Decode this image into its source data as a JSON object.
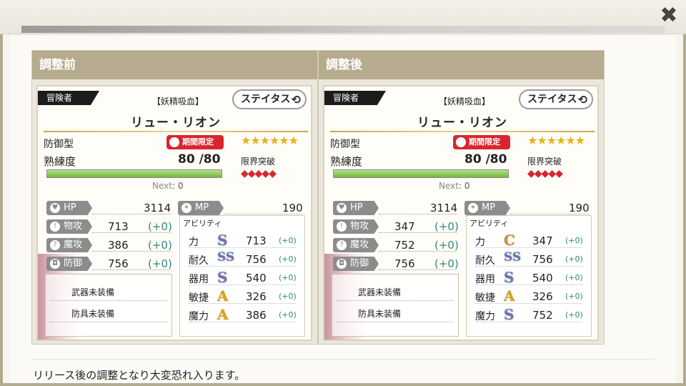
{
  "modal": {
    "close_label": "✖"
  },
  "panels": [
    {
      "header": "調整前",
      "card": {
        "tag": "冒険者",
        "subtitle": "【妖精吸血】",
        "status_button": "ステイタス",
        "name": "リュー・リオン",
        "role": "防御型",
        "limited_badge": "期間限定",
        "stars": "★★★★★★",
        "proficiency_label": "熟練度",
        "proficiency_value": "80 /80",
        "proficiency_progress": 1.0,
        "limit_break_label": "限界突破",
        "limit_diamonds": "◆◆◆◆◆",
        "next_label": "Next",
        "next_value": ": 0",
        "hp_label": "HP",
        "hp_value": "3114",
        "mp_label": "MP",
        "mp_value": "190",
        "stats": [
          {
            "label": "物攻",
            "value": "713",
            "delta": "(+0)"
          },
          {
            "label": "魔攻",
            "value": "386",
            "delta": "(+0)"
          },
          {
            "label": "防御",
            "value": "756",
            "delta": "(+0)"
          }
        ],
        "equipment": {
          "weapon": "武器未装備",
          "armor": "防具未装備"
        },
        "ability_title": "アビリティ",
        "abilities": [
          {
            "label": "力",
            "grade": "S",
            "value": "713",
            "delta": "(+0)"
          },
          {
            "label": "耐久",
            "grade": "SS",
            "value": "756",
            "delta": "(+0)"
          },
          {
            "label": "器用",
            "grade": "S",
            "value": "540",
            "delta": "(+0)"
          },
          {
            "label": "敏捷",
            "grade": "A",
            "value": "326",
            "delta": "(+0)"
          },
          {
            "label": "魔力",
            "grade": "A",
            "value": "386",
            "delta": "(+0)"
          }
        ]
      }
    },
    {
      "header": "調整後",
      "card": {
        "tag": "冒険者",
        "subtitle": "【妖精吸血】",
        "status_button": "ステイタス",
        "name": "リュー・リオン",
        "role": "防御型",
        "limited_badge": "期間限定",
        "stars": "★★★★★★",
        "proficiency_label": "熟練度",
        "proficiency_value": "80 /80",
        "proficiency_progress": 1.0,
        "limit_break_label": "限界突破",
        "limit_diamonds": "◆◆◆◆◆",
        "next_label": "Next",
        "next_value": ": 0",
        "hp_label": "HP",
        "hp_value": "3114",
        "mp_label": "MP",
        "mp_value": "190",
        "stats": [
          {
            "label": "物攻",
            "value": "347",
            "delta": "(+0)"
          },
          {
            "label": "魔攻",
            "value": "752",
            "delta": "(+0)"
          },
          {
            "label": "防御",
            "value": "756",
            "delta": "(+0)"
          }
        ],
        "equipment": {
          "weapon": "武器未装備",
          "armor": "防具未装備"
        },
        "ability_title": "アビリティ",
        "abilities": [
          {
            "label": "力",
            "grade": "C",
            "value": "347",
            "delta": "(+0)"
          },
          {
            "label": "耐久",
            "grade": "SS",
            "value": "756",
            "delta": "(+0)"
          },
          {
            "label": "器用",
            "grade": "S",
            "value": "540",
            "delta": "(+0)"
          },
          {
            "label": "敏捷",
            "grade": "A",
            "value": "326",
            "delta": "(+0)"
          },
          {
            "label": "魔力",
            "grade": "S",
            "value": "752",
            "delta": "(+0)"
          }
        ]
      }
    }
  ],
  "footer_note": "リリース後の調整となり大変恐れ入ります。",
  "colors": {
    "header": "#b6ab8e",
    "limited": "#d8262f",
    "delta": "#2e8a7e",
    "stars": "#e7b31b"
  },
  "icons": {
    "close": "close-icon",
    "status_refresh": "refresh-icon",
    "limited": "mask-icon"
  }
}
